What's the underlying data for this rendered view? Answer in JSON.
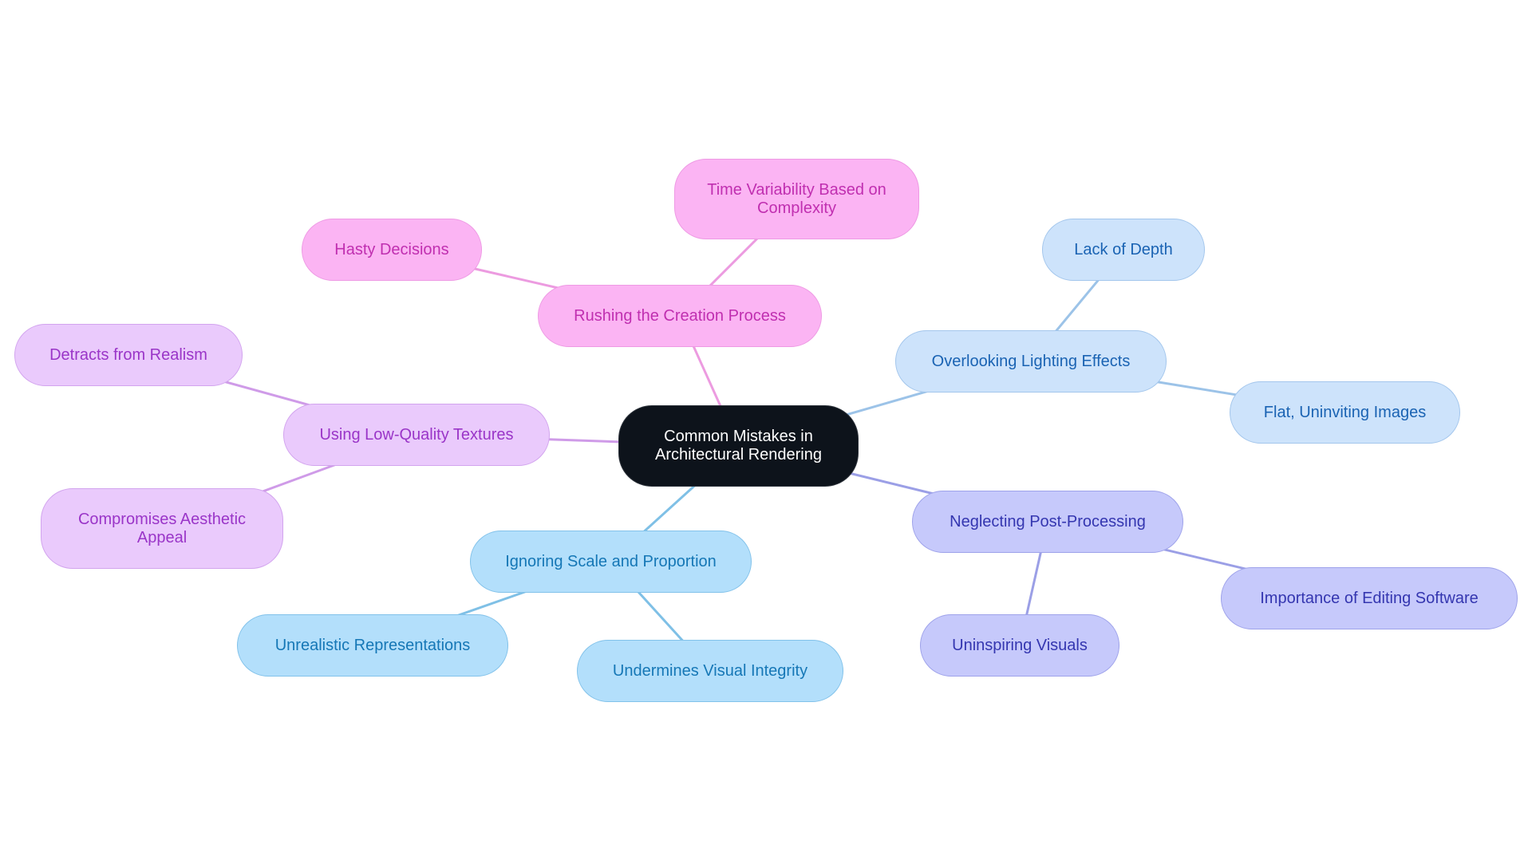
{
  "diagram": {
    "type": "mindmap",
    "root": {
      "id": "root",
      "label": "Common Mistakes in Architectural Rendering",
      "colors": {
        "fill": "#0d131b",
        "stroke": "#2d333b",
        "text": "#ffffff"
      }
    },
    "branches": [
      {
        "id": "rushing",
        "label": "Rushing the Creation Process",
        "colors": {
          "fill": "#fbb4f3",
          "stroke": "#ee9ae4",
          "text": "#c02fb0",
          "edge": "#ec9be0"
        },
        "children": [
          {
            "id": "time",
            "label": "Time Variability Based on Complexity"
          },
          {
            "id": "hasty",
            "label": "Hasty Decisions"
          }
        ]
      },
      {
        "id": "lighting",
        "label": "Overlooking Lighting Effects",
        "colors": {
          "fill": "#cde3fb",
          "stroke": "#a3c6ec",
          "text": "#1a63b3",
          "edge": "#9cc3e8"
        },
        "children": [
          {
            "id": "depth",
            "label": "Lack of Depth"
          },
          {
            "id": "flat",
            "label": "Flat, Uninviting Images"
          }
        ]
      },
      {
        "id": "textures",
        "label": "Using Low-Quality Textures",
        "colors": {
          "fill": "#eacafc",
          "stroke": "#d2a4ee",
          "text": "#9a35c8",
          "edge": "#cf9be8"
        },
        "children": [
          {
            "id": "realism",
            "label": "Detracts from Realism"
          },
          {
            "id": "aesthetic",
            "label": "Compromises Aesthetic Appeal"
          }
        ]
      },
      {
        "id": "scale",
        "label": "Ignoring Scale and Proportion",
        "colors": {
          "fill": "#b3dffb",
          "stroke": "#82c2ea",
          "text": "#1577b6",
          "edge": "#7fc0e6"
        },
        "children": [
          {
            "id": "unrealistic",
            "label": "Unrealistic Representations"
          },
          {
            "id": "integrity",
            "label": "Undermines Visual Integrity"
          }
        ]
      },
      {
        "id": "post",
        "label": "Neglecting Post-Processing",
        "colors": {
          "fill": "#c6c9fb",
          "stroke": "#9ea2ea",
          "text": "#3436b0",
          "edge": "#9b9fe6"
        },
        "children": [
          {
            "id": "software",
            "label": "Importance of Editing Software"
          },
          {
            "id": "uninspiring",
            "label": "Uninspiring Visuals"
          }
        ]
      }
    ]
  }
}
